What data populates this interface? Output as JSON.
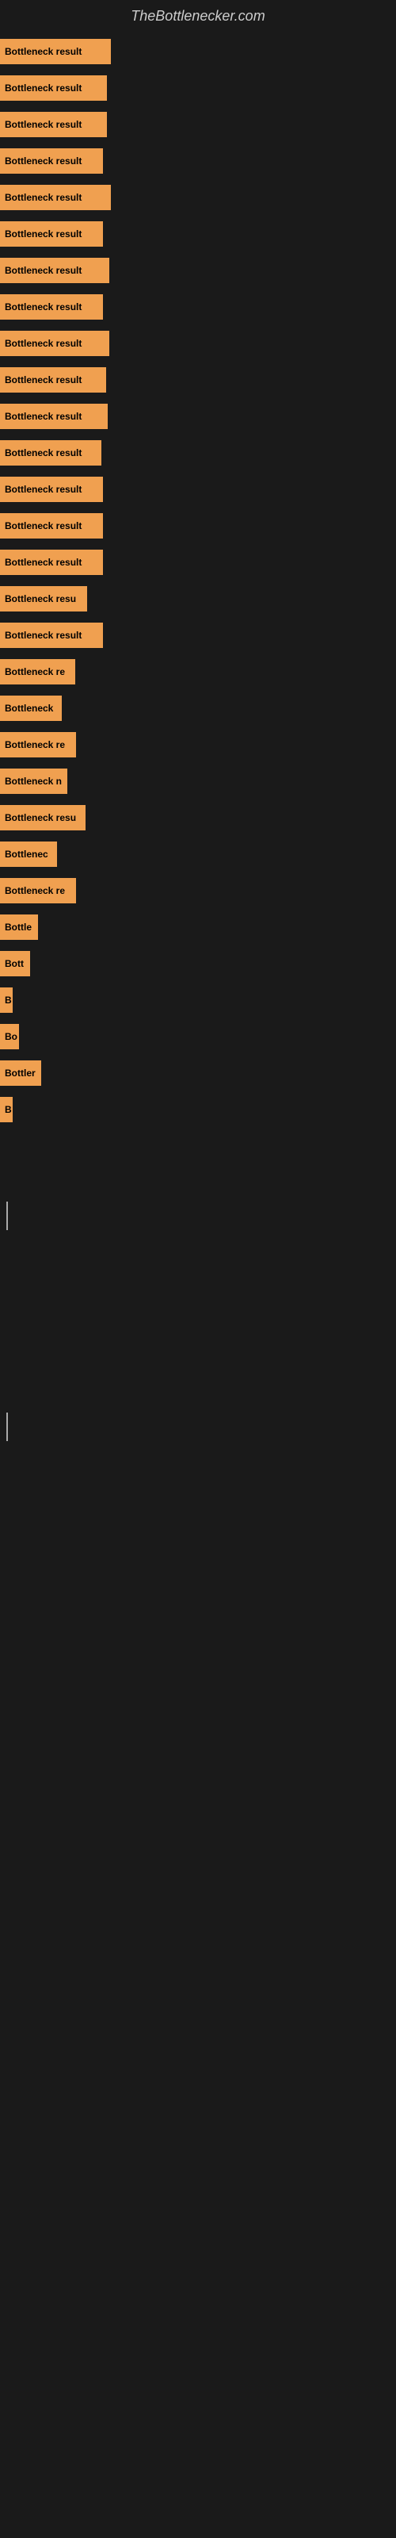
{
  "site": {
    "title": "TheBottlenecker.com"
  },
  "bars": [
    {
      "label": "Bottleneck result",
      "width": 140
    },
    {
      "label": "Bottleneck result",
      "width": 135
    },
    {
      "label": "Bottleneck result",
      "width": 135
    },
    {
      "label": "Bottleneck result",
      "width": 130
    },
    {
      "label": "Bottleneck result",
      "width": 140
    },
    {
      "label": "Bottleneck result",
      "width": 130
    },
    {
      "label": "Bottleneck result",
      "width": 138
    },
    {
      "label": "Bottleneck result",
      "width": 130
    },
    {
      "label": "Bottleneck result",
      "width": 138
    },
    {
      "label": "Bottleneck result",
      "width": 134
    },
    {
      "label": "Bottleneck result",
      "width": 136
    },
    {
      "label": "Bottleneck result",
      "width": 128
    },
    {
      "label": "Bottleneck result",
      "width": 130
    },
    {
      "label": "Bottleneck result",
      "width": 130
    },
    {
      "label": "Bottleneck result",
      "width": 130
    },
    {
      "label": "Bottleneck resu",
      "width": 110
    },
    {
      "label": "Bottleneck result",
      "width": 130
    },
    {
      "label": "Bottleneck re",
      "width": 95
    },
    {
      "label": "Bottleneck",
      "width": 78
    },
    {
      "label": "Bottleneck re",
      "width": 96
    },
    {
      "label": "Bottleneck n",
      "width": 85
    },
    {
      "label": "Bottleneck resu",
      "width": 108
    },
    {
      "label": "Bottlenec",
      "width": 72
    },
    {
      "label": "Bottleneck re",
      "width": 96
    },
    {
      "label": "Bottle",
      "width": 48
    },
    {
      "label": "Bott",
      "width": 38
    },
    {
      "label": "B",
      "width": 16
    },
    {
      "label": "Bo",
      "width": 24
    },
    {
      "label": "Bottler",
      "width": 52
    },
    {
      "label": "B",
      "width": 16
    },
    {
      "label": "",
      "width": 0
    },
    {
      "label": "",
      "width": 0
    },
    {
      "label": "|",
      "width": 0,
      "cursor": true
    },
    {
      "label": "",
      "width": 0
    },
    {
      "label": "",
      "width": 0
    },
    {
      "label": "",
      "width": 0
    },
    {
      "label": "",
      "width": 0
    },
    {
      "label": "",
      "width": 0
    },
    {
      "label": "|",
      "width": 0,
      "cursor": true
    }
  ]
}
